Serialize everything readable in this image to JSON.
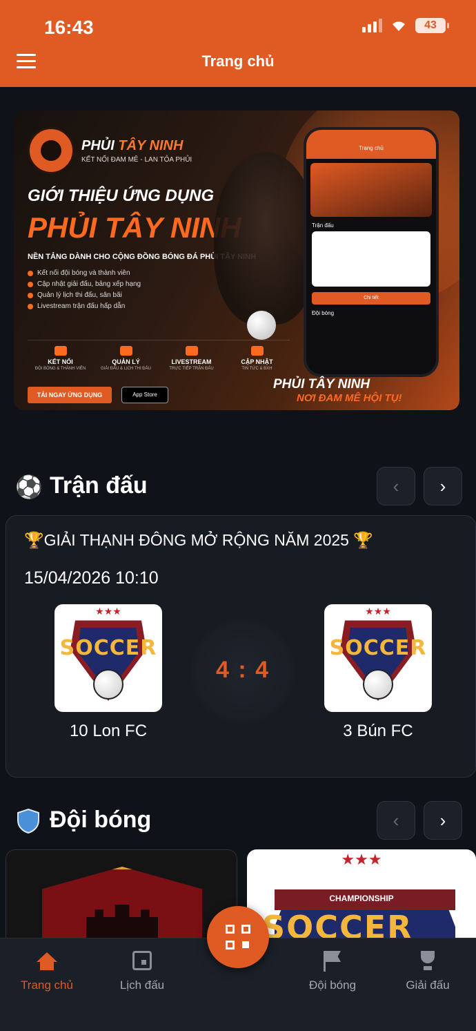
{
  "status_bar": {
    "time": "16:43",
    "battery": "43"
  },
  "header": {
    "title": "Trang chủ"
  },
  "banner": {
    "brand_main": "PHỦI",
    "brand_accent": "TÂY NINH",
    "slogan": "KẾT NỐI ĐAM MÊ - LAN TỎA PHỦI",
    "intro": "GIỚI THIỆU ỨNG DỤNG",
    "app_name": "PHỦI TÂY NINH",
    "description": "NỀN TẢNG DÀNH CHO CỘNG ĐỒNG BÓNG ĐÁ PHỦI TÂY NINH",
    "features": [
      "Kết nối đội bóng và thành viên",
      "Cập nhật giải đấu, bảng xếp hạng",
      "Quản lý lịch thi đấu, sân bãi",
      "Livestream trận đấu hấp dẫn"
    ],
    "pillars": [
      {
        "title": "KẾT NỐI",
        "sub": "ĐỘI BÓNG & THÀNH VIÊN"
      },
      {
        "title": "QUẢN LÝ",
        "sub": "GIẢI ĐẤU & LỊCH THI ĐẤU"
      },
      {
        "title": "LIVESTREAM",
        "sub": "TRỰC TIẾP TRẬN ĐẤU"
      },
      {
        "title": "CẬP NHẬT",
        "sub": "TIN TỨC & BXH"
      }
    ],
    "download_label": "TẢI NGAY ỨNG DỤNG",
    "appstore_label": "App Store",
    "footer_line1": "PHỦI TÂY NINH",
    "footer_line2": "NƠI ĐAM MÊ HỘI TỤ!",
    "phone_header": "Trang chủ",
    "phone_section1": "Trận đấu",
    "phone_button": "Chi tiết",
    "phone_section2": "Đội bóng"
  },
  "matches_section": {
    "icon": "⚽",
    "title": "Trận đấu",
    "prev": "‹",
    "next": "›",
    "match": {
      "tournament": "GIẢI THẠNH ĐÔNG MỞ RỘNG NĂM 2025",
      "trophy_icon": "🏆",
      "datetime": "15/04/2026 10:10",
      "home_team": "10 Lon FC",
      "away_team": "3 Bún FC",
      "score": "4 : 4",
      "crest_word": "SOCCER"
    }
  },
  "teams_section": {
    "title": "Đội bóng",
    "prev": "‹",
    "next": "›",
    "light_card_label": "CHAMPIONSHIP",
    "light_card_word": "SOCCER"
  },
  "bottom_nav": {
    "home": "Trang chủ",
    "schedule": "Lịch đấu",
    "teams": "Đội bóng",
    "tournaments": "Giải đấu"
  },
  "colors": {
    "accent": "#e05a23",
    "background": "#0f1218",
    "card": "#171b22"
  },
  "icons": [
    "menu-icon",
    "soccer-ball-icon",
    "shield-icon",
    "chevron-left-icon",
    "chevron-right-icon",
    "home-icon",
    "calendar-icon",
    "qr-code-icon",
    "flag-icon",
    "trophy-icon"
  ]
}
